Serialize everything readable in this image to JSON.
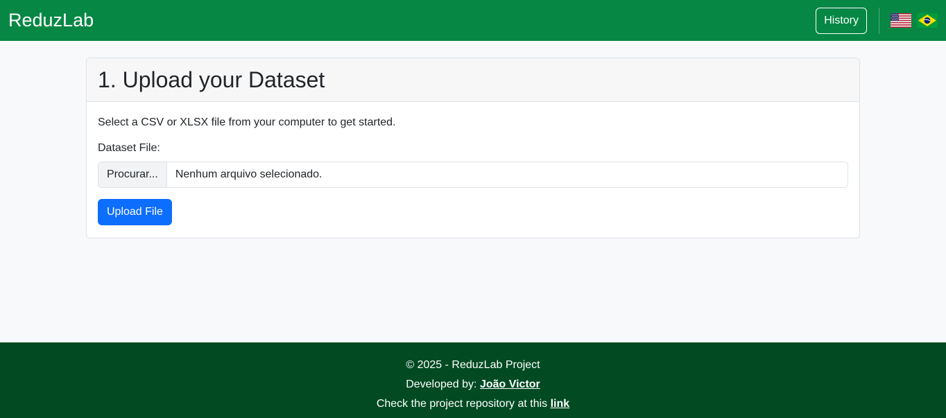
{
  "navbar": {
    "brand": "ReduzLab",
    "history_label": "History",
    "flags": [
      {
        "icon": "us-flag-icon",
        "language": "English"
      },
      {
        "icon": "brazil-flag-icon",
        "language": "Português"
      }
    ],
    "color": "#068744"
  },
  "card": {
    "title": "1. Upload your Dataset",
    "intro": "Select a CSV or XLSX file from your computer to get started.",
    "field_label": "Dataset File:",
    "file_button_label": "Procurar...",
    "file_status": "Nenhum arquivo selecionado.",
    "upload_label": "Upload File",
    "accent_color": "#0d6efd"
  },
  "footer": {
    "copyright": "© 2025 - ReduzLab Project",
    "developed_prefix": "Developed by:",
    "developer_name": "João Victor",
    "repo_prefix": "Check the project repository at this",
    "repo_link_label": "link",
    "color": "#014a22"
  }
}
